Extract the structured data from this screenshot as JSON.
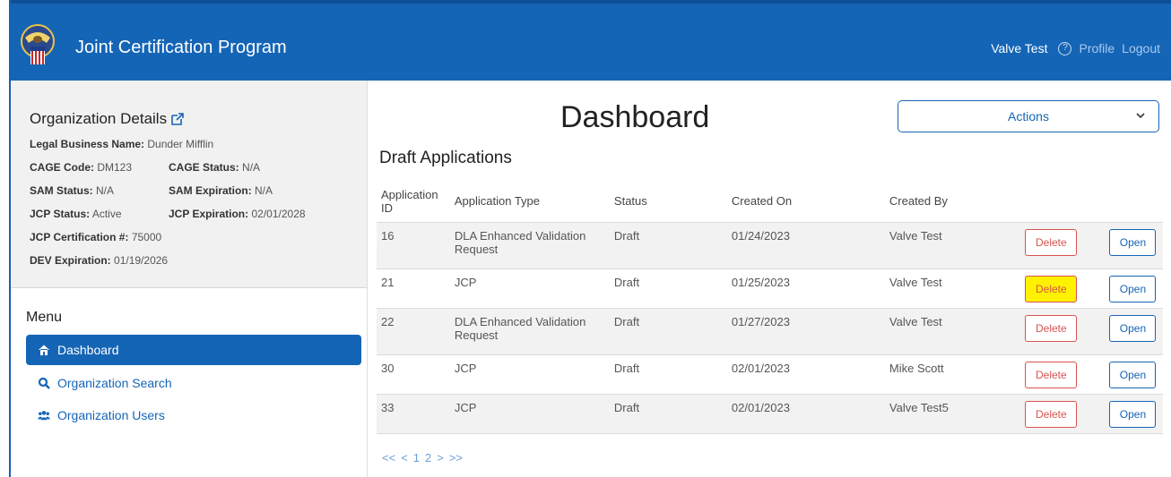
{
  "header": {
    "app_title": "Joint Certification Program",
    "user_name": "Valve Test",
    "profile_label": "Profile",
    "logout_label": "Logout"
  },
  "org_details": {
    "title": "Organization Details",
    "legal_name_label": "Legal Business Name:",
    "legal_name": "Dunder Mifflin",
    "cage_code_label": "CAGE Code:",
    "cage_code": "DM123",
    "cage_status_label": "CAGE Status:",
    "cage_status": "N/A",
    "sam_status_label": "SAM Status:",
    "sam_status": "N/A",
    "sam_expiration_label": "SAM Expiration:",
    "sam_expiration": "N/A",
    "jcp_status_label": "JCP Status:",
    "jcp_status": "Active",
    "jcp_expiration_label": "JCP Expiration:",
    "jcp_expiration": "02/01/2028",
    "jcp_cert_label": "JCP Certification #:",
    "jcp_cert": "75000",
    "dev_expiration_label": "DEV Expiration:",
    "dev_expiration": "01/19/2026"
  },
  "menu": {
    "title": "Menu",
    "items": [
      {
        "label": "Dashboard",
        "icon": "home-icon"
      },
      {
        "label": "Organization Search",
        "icon": "search-icon"
      },
      {
        "label": "Organization Users",
        "icon": "users-icon"
      }
    ]
  },
  "main": {
    "title": "Dashboard",
    "actions_label": "Actions",
    "section_title": "Draft Applications",
    "columns": [
      "Application ID",
      "Application Type",
      "Status",
      "Created On",
      "Created By"
    ],
    "delete_label": "Delete",
    "open_label": "Open",
    "rows": [
      {
        "id": "16",
        "type": "DLA Enhanced Validation Request",
        "status": "Draft",
        "created_on": "01/24/2023",
        "created_by": "Valve Test"
      },
      {
        "id": "21",
        "type": "JCP",
        "status": "Draft",
        "created_on": "01/25/2023",
        "created_by": "Valve Test"
      },
      {
        "id": "22",
        "type": "DLA Enhanced Validation Request",
        "status": "Draft",
        "created_on": "01/27/2023",
        "created_by": "Valve Test"
      },
      {
        "id": "30",
        "type": "JCP",
        "status": "Draft",
        "created_on": "02/01/2023",
        "created_by": "Mike Scott"
      },
      {
        "id": "33",
        "type": "JCP",
        "status": "Draft",
        "created_on": "02/01/2023",
        "created_by": "Valve Test5"
      }
    ]
  },
  "pager": {
    "first": "<<",
    "prev": "<",
    "page1": "1",
    "page2": "2",
    "next": ">",
    "last": ">>"
  },
  "colors": {
    "brand_blue": "#1565b6",
    "delete_red": "#d9534f",
    "highlight_yellow": "#fff200"
  }
}
